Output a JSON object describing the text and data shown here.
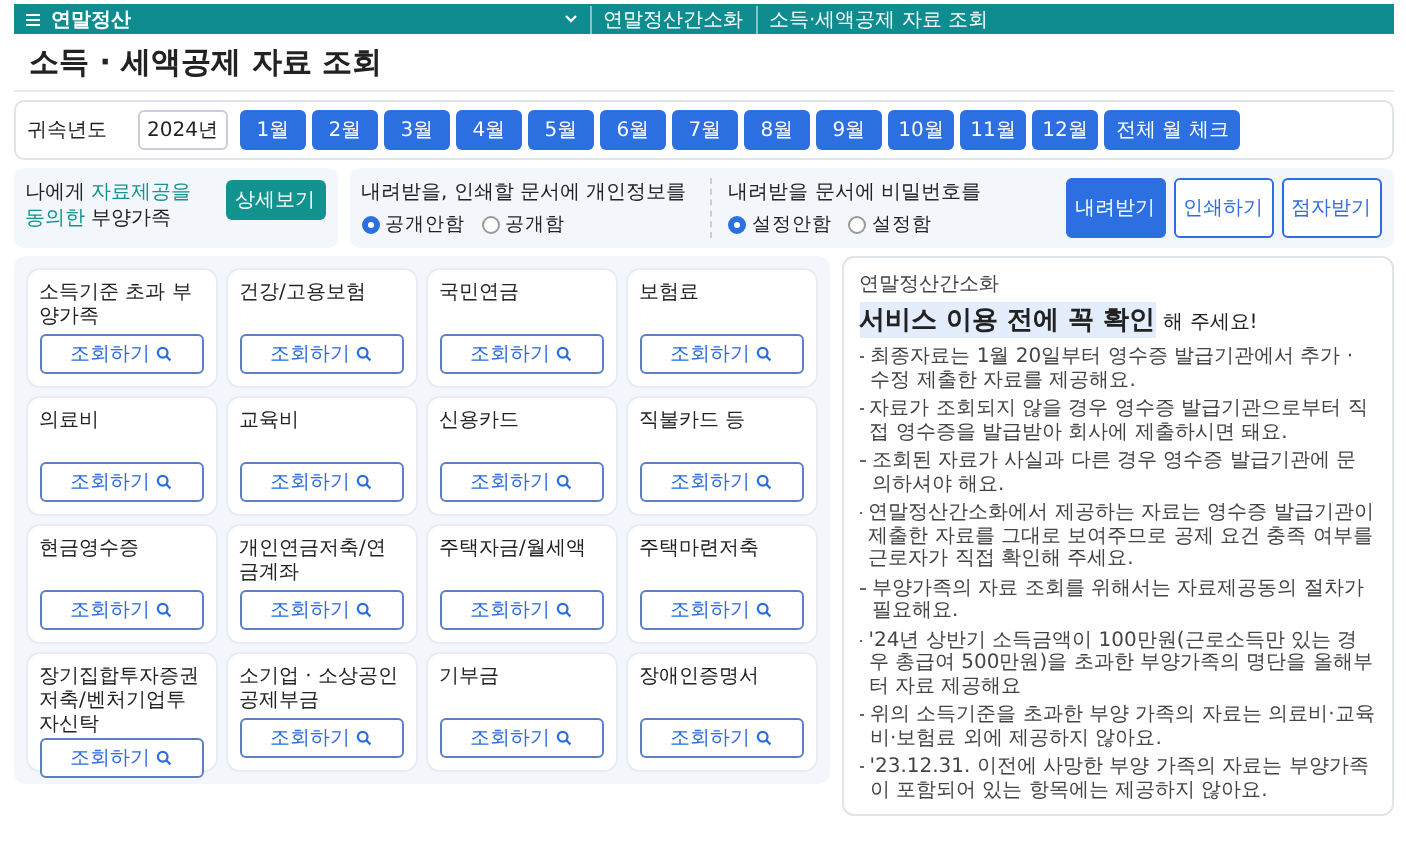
{
  "topbar": {
    "section": "연말정산",
    "breadcrumbs": [
      "연말정산간소화",
      "소득·세액공제 자료 조회"
    ]
  },
  "title": "소득 · 세액공제 자료 조회",
  "year_filter": {
    "label": "귀속년도",
    "year": "2024년",
    "months": [
      "1월",
      "2월",
      "3월",
      "4월",
      "5월",
      "6월",
      "7월",
      "8월",
      "9월",
      "10월",
      "11월",
      "12월"
    ],
    "all_button": "전체 월 체크"
  },
  "dependents": {
    "text": "나에게 **자료제공을 동의한** 부양가족",
    "button": "상세보기"
  },
  "options": [
    {
      "label": "내려받을, 인쇄할 문서에 개인정보를",
      "choices": [
        {
          "label": "공개안함",
          "selected": true
        },
        {
          "label": "공개함",
          "selected": false
        }
      ]
    },
    {
      "label": "내려받을 문서에 비밀번호를",
      "choices": [
        {
          "label": "설정안함",
          "selected": true
        },
        {
          "label": "설정함",
          "selected": false
        }
      ]
    }
  ],
  "actions": [
    {
      "label": "내려받기",
      "primary": true
    },
    {
      "label": "인쇄하기",
      "primary": false
    },
    {
      "label": "점자받기",
      "primary": false
    }
  ],
  "categories": [
    {
      "name": "소득기준 초과 부양가족",
      "button": "조회하기"
    },
    {
      "name": "건강/고용보험",
      "button": "조회하기"
    },
    {
      "name": "국민연금",
      "button": "조회하기"
    },
    {
      "name": "보험료",
      "button": "조회하기"
    },
    {
      "name": "의료비",
      "button": "조회하기"
    },
    {
      "name": "교육비",
      "button": "조회하기"
    },
    {
      "name": "신용카드",
      "button": "조회하기"
    },
    {
      "name": "직불카드 등",
      "button": "조회하기"
    },
    {
      "name": "현금영수증",
      "button": "조회하기"
    },
    {
      "name": "개인연금저축/연금계좌",
      "button": "조회하기"
    },
    {
      "name": "주택자금/월세액",
      "button": "조회하기"
    },
    {
      "name": "주택마련저축",
      "button": "조회하기"
    },
    {
      "name": "장기집합투자증권저축/벤처기업투자신탁",
      "button": "조회하기"
    },
    {
      "name": "소기업 · 소상공인 공제부금",
      "button": "조회하기"
    },
    {
      "name": "기부금",
      "button": "조회하기"
    },
    {
      "name": "장애인증명서",
      "button": "조회하기"
    }
  ],
  "notice": {
    "source": "연말정산간소화",
    "heading": "서비스 이용 전에 꼭 확인",
    "heading_suffix": "해 주세요!",
    "items": [
      "최종자료는 1월 20일부터 영수증 발급기관에서 추가 · 수정 제출한 자료를 제공해요.",
      "자료가 조회되지 않을 경우 영수증 발급기관으로부터 직접 영수증을 발급받아 회사에 제출하시면 돼요.",
      "조회된 자료가 사실과 다른 경우 영수증 발급기관에 문의하셔야 해요.",
      "연말정산간소화에서 제공하는 자료는 영수증 발급기관이 제출한 자료를 그대로 보여주므로 공제 요건 충족 여부를 근로자가 직접 확인해 주세요.",
      "부양가족의 자료 조회를 위해서는 자료제공동의 절차가 필요해요.",
      "'24년 상반기 소득금액이 100만원(근로소득만 있는 경우 총급여 500만원)을 초과한 부양가족의 명단을 올해부터 자료 제공해요",
      "위의 소득기준을 초과한 부양 가족의 자료는 의료비·교육비·보험료 외에 제공하지 않아요.",
      "'23.12.31. 이전에 사망한 부양 가족의 자료는 부양가족이 포함되어 있는 항목에는 제공하지 않아요."
    ]
  }
}
